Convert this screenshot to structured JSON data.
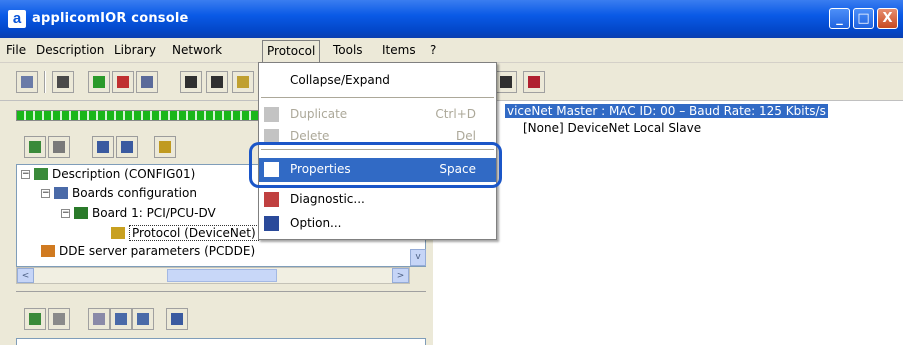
{
  "window": {
    "logo_letter": "a",
    "title": "applicomIOR console",
    "controls": {
      "minimize": "_",
      "maximize": "□",
      "close": "X"
    }
  },
  "menubar": {
    "items": [
      "File",
      "Description",
      "Library",
      "Network",
      "Protocol",
      "Tools",
      "Items",
      "?"
    ]
  },
  "toolbar": {
    "icons": [
      "save-icon",
      "print-icon",
      "card-icon",
      "board-icon",
      "monitor-icon",
      "window-icon",
      "window-alt-icon",
      "help-icon",
      "tool-icon",
      "plug-icon"
    ]
  },
  "left_panel": {
    "tree": [
      {
        "label": "Description (CONFIG01)",
        "icon": "description-icon",
        "expander": "−"
      },
      {
        "label": "Boards configuration",
        "icon": "boards-icon",
        "expander": "−"
      },
      {
        "label": "Board 1:   PCI/PCU-DV",
        "icon": "board-icon",
        "expander": "−"
      },
      {
        "label": "Protocol (DeviceNet)",
        "icon": "protocol-icon",
        "expander": ""
      },
      {
        "label": "DDE server parameters (PCDDE)",
        "icon": "dde-icon",
        "expander": ""
      }
    ],
    "scroll": {
      "left_arrow": "<",
      "right_arrow": ">",
      "down_arrow": "v"
    }
  },
  "right_panel": {
    "rows": [
      {
        "text": "viceNet Master :  MAC ID: 00  –  Baud Rate: 125 Kbits/s",
        "selected": true
      },
      {
        "text": "[None]  DeviceNet Local Slave",
        "selected": false
      }
    ]
  },
  "protocol_menu": {
    "items": [
      {
        "label": "Collapse/Expand",
        "shortcut": "",
        "icon": "",
        "state": "normal"
      },
      {
        "label": "Duplicate",
        "shortcut": "Ctrl+D",
        "icon": "duplicate-icon",
        "state": "disabled"
      },
      {
        "label": "Delete",
        "shortcut": "Del",
        "icon": "delete-icon",
        "state": "disabled"
      },
      {
        "label": "Properties",
        "shortcut": "Space",
        "icon": "properties-icon",
        "state": "highlighted"
      },
      {
        "label": "Diagnostic...",
        "shortcut": "",
        "icon": "diagnostic-icon",
        "state": "normal"
      },
      {
        "label": "Option...",
        "shortcut": "",
        "icon": "option-icon",
        "state": "normal"
      }
    ]
  },
  "colors": {
    "accent": "#316ac5",
    "titlebar": "#0a55d8",
    "highlight_ring": "#1b56c8",
    "progress": "#1ab61a"
  }
}
